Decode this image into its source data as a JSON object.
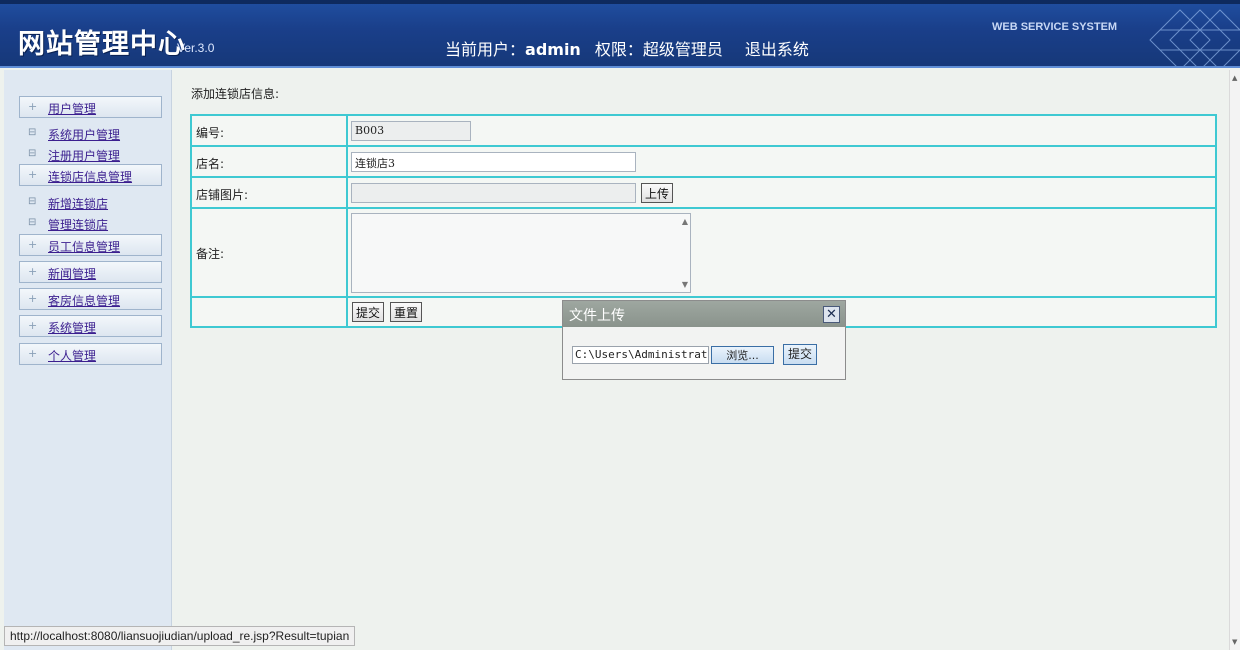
{
  "header": {
    "logo": "网站管理中心",
    "version": "Ver.3.0",
    "current_user_label": "当前用户：",
    "current_user": "admin",
    "permission_label": "权限：",
    "permission": "超级管理员",
    "logout": "退出系统",
    "tagline": "WEB SERVICE SYSTEM"
  },
  "sidebar": {
    "user_mgmt": "用户管理",
    "sys_user_mgmt": "系统用户管理",
    "reg_user_mgmt": "注册用户管理",
    "chain_info_mgmt": "连锁店信息管理",
    "add_chain": "新增连锁店",
    "manage_chain": "管理连锁店",
    "staff_mgmt": "员工信息管理",
    "news_mgmt": "新闻管理",
    "room_mgmt": "客房信息管理",
    "system_mgmt": "系统管理",
    "personal_mgmt": "个人管理"
  },
  "main": {
    "title": "添加连锁店信息:",
    "code_label": "编号:",
    "code_value": "B003",
    "name_label": "店名:",
    "name_value": "连锁店3",
    "image_label": "店铺图片:",
    "image_value": "",
    "upload_btn": "上传",
    "remark_label": "备注:",
    "remark_value": "",
    "submit_btn": "提交",
    "reset_btn": "重置"
  },
  "dialog": {
    "title": "文件上传",
    "path_value": "C:\\Users\\Administrator",
    "browse_btn": "浏览...",
    "submit_btn": "提交"
  },
  "status_url": "http://localhost:8080/liansuojiudian/upload_re.jsp?Result=tupian",
  "colors": {
    "header_bg": "#1a3f8a",
    "table_border": "#3ec9d2",
    "link": "#3b1f8f"
  }
}
